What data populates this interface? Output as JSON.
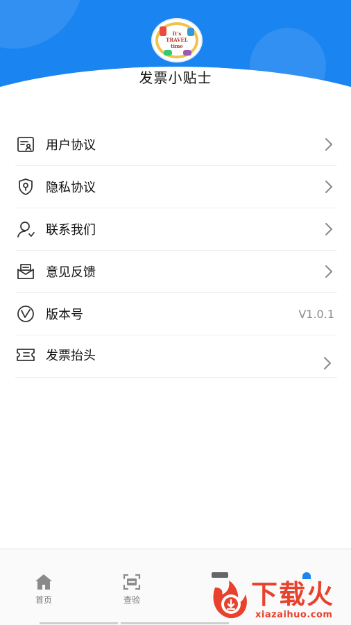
{
  "header": {
    "title": "发票小贴士",
    "logo_text": "It's\nTRAVEL\ntime",
    "brand_color": "#1a84f0"
  },
  "menu": {
    "items": [
      {
        "label": "用户协议",
        "icon": "user-agreement-icon"
      },
      {
        "label": "隐私协议",
        "icon": "privacy-shield-icon"
      },
      {
        "label": "联系我们",
        "icon": "contact-person-icon"
      },
      {
        "label": "意见反馈",
        "icon": "feedback-mail-icon"
      },
      {
        "label": "版本号",
        "icon": "version-v-icon",
        "value": "V1.0.1"
      },
      {
        "label": "发票抬头",
        "icon": "ticket-icon"
      }
    ]
  },
  "bottom_nav": {
    "items": [
      {
        "label": "首页",
        "icon": "home-icon"
      },
      {
        "label": "查验",
        "icon": "scan-icon"
      }
    ]
  },
  "watermark": {
    "text": "下载火",
    "url": "xiazaihuo.com",
    "color": "#e8422d"
  }
}
